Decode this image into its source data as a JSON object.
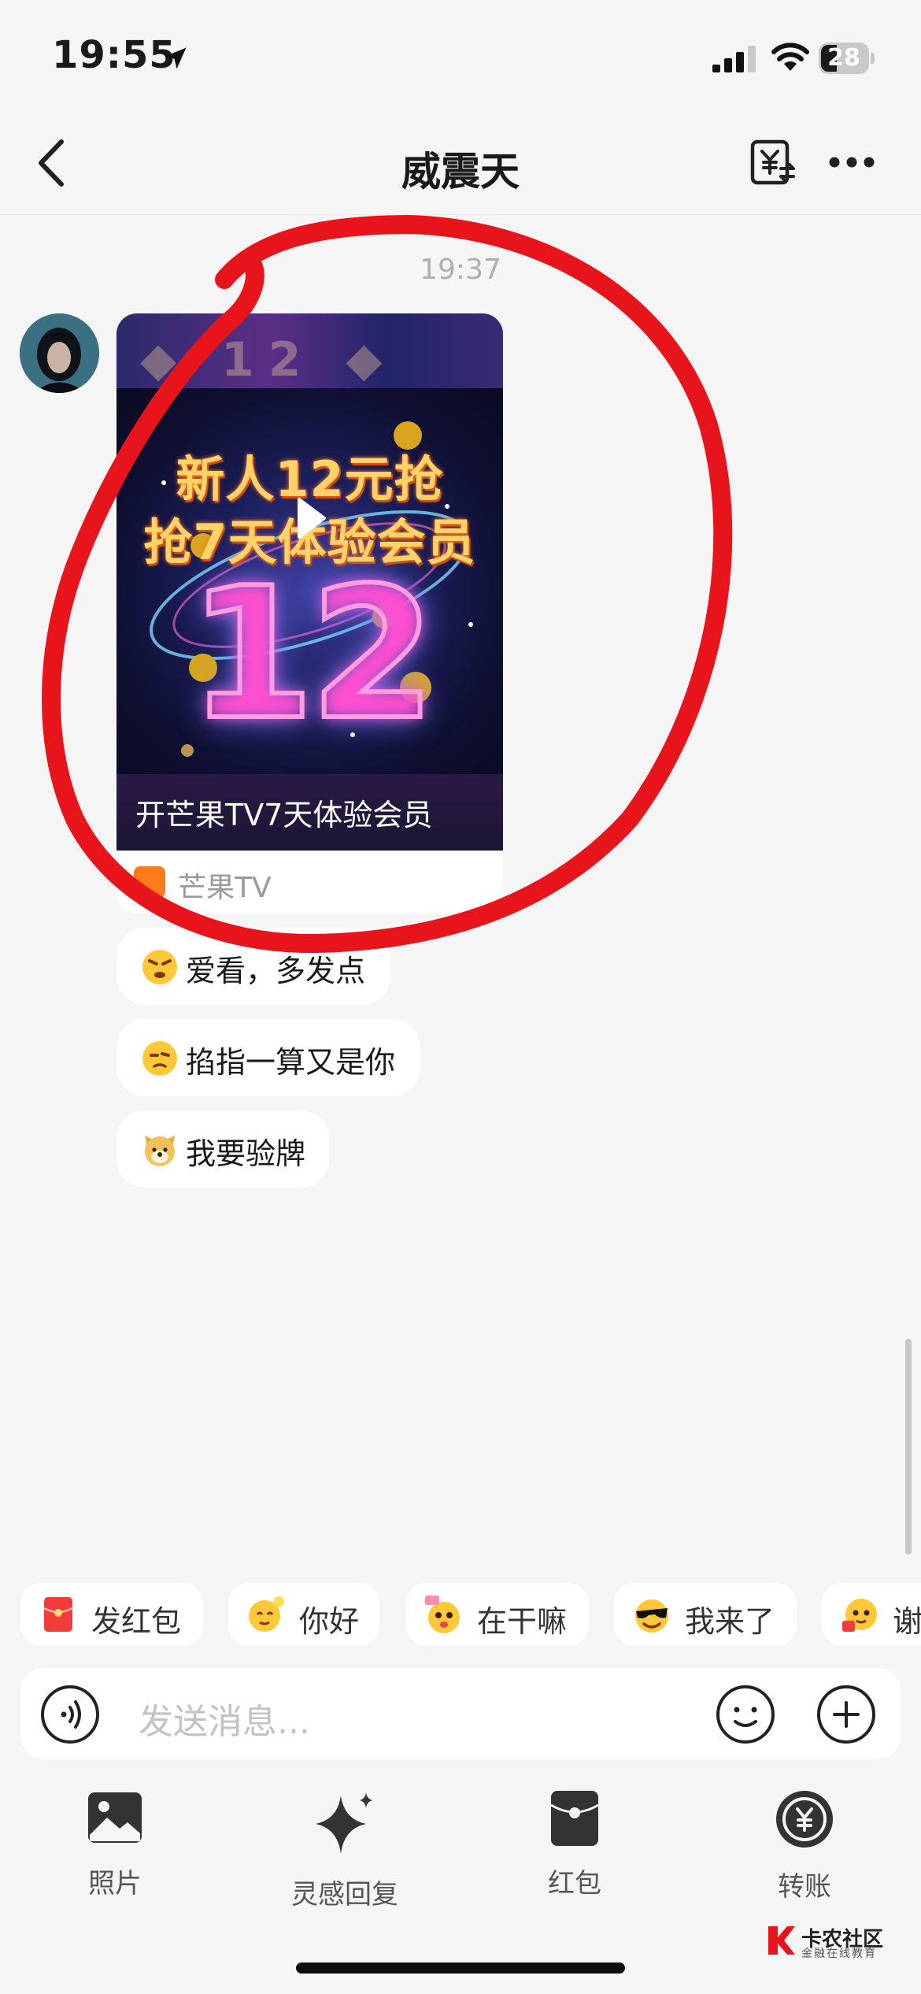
{
  "status": {
    "time": "19:55",
    "battery": "28"
  },
  "header": {
    "title": "威震天"
  },
  "chat": {
    "time": "19:37",
    "card": {
      "promo_line1": "新人12元抢",
      "promo_line2": "抢7天体验会员",
      "promo_big": "12",
      "caption": "开芒果TV7天体验会员",
      "source": "芒果TV"
    },
    "messages": [
      "爱看，多发点",
      "掐指一算又是你",
      "我要验牌"
    ]
  },
  "quick_replies": [
    "发红包",
    "你好",
    "在干嘛",
    "我来了",
    "谢"
  ],
  "input": {
    "placeholder": "发送消息..."
  },
  "toolbar": {
    "photo": "照片",
    "inspire": "灵感回复",
    "red_packet": "红包",
    "transfer": "转账"
  },
  "watermark": {
    "name": "卡农社区",
    "slogan": "金融在线教育"
  },
  "colors": {
    "scribble": "#e8141c",
    "accent": "#ff7a1a",
    "background": "#f5f5f5"
  },
  "icons": [
    "location-arrow-icon",
    "signal-icon",
    "wifi-icon",
    "back-icon",
    "yuan-transfer-icon",
    "more-icon",
    "play-icon",
    "voice-icon",
    "emoji-icon",
    "plus-icon",
    "image-icon",
    "sparkle-icon",
    "red-packet-icon",
    "transfer-icon"
  ]
}
